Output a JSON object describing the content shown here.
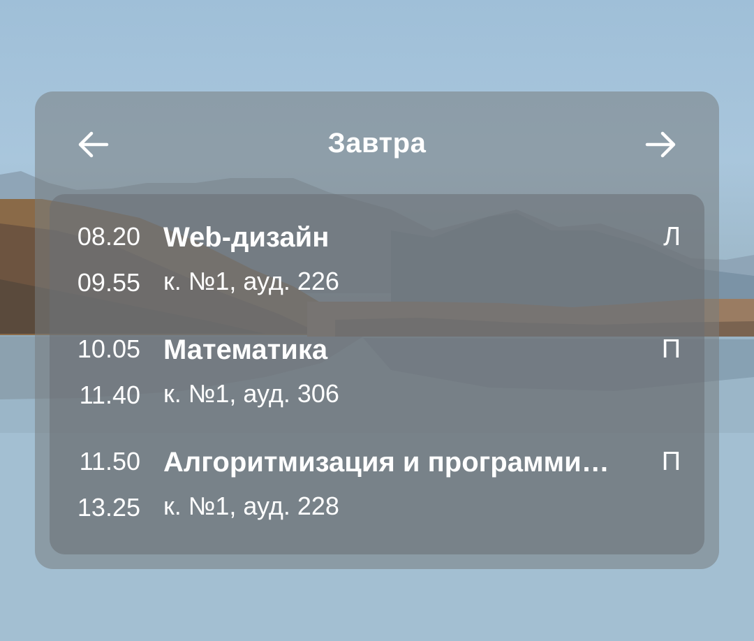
{
  "header": {
    "title": "Завтра",
    "prev_icon": "arrow-left-icon",
    "next_icon": "arrow-right-icon"
  },
  "lessons": [
    {
      "start": "08.20",
      "end": "09.55",
      "subject": "Web-дизайн",
      "place": "к. №1, ауд. 226",
      "type": "Л"
    },
    {
      "start": "10.05",
      "end": "11.40",
      "subject": "Математика",
      "place": "к. №1, ауд. 306",
      "type": "П"
    },
    {
      "start": "11.50",
      "end": "13.25",
      "subject": "Алгоритмизация и программи…",
      "place": "к. №1, ауд. 228",
      "type": "П"
    }
  ],
  "colors": {
    "text": "#ffffff",
    "card_bg": "#787d80",
    "list_bg": "#696e72"
  }
}
